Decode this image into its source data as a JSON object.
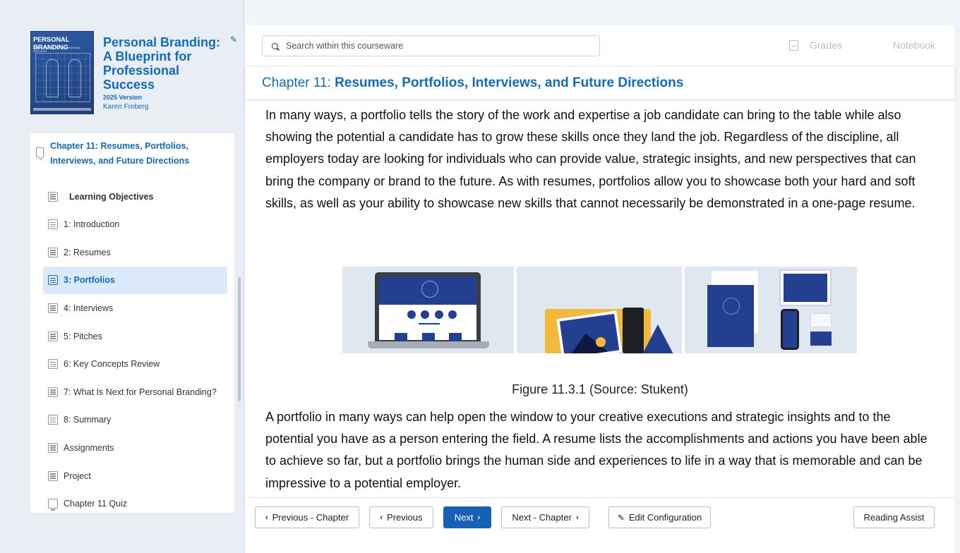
{
  "book": {
    "cover_title": "PERSONAL BRANDING",
    "cover_subtitle": "A BLUEPRINT FOR PROFESSIONAL SUCCESS",
    "title": "Personal Branding: A Blueprint for Professional Success",
    "version": "2025 Version",
    "author": "Karen Freberg"
  },
  "toc": {
    "chapter_label": "Chapter 11: Resumes, Portfolios, Interviews, and Future Directions",
    "items": [
      {
        "label": "Learning Objectives",
        "icon": "page-icon"
      },
      {
        "label": "1: Introduction",
        "icon": "page-icon"
      },
      {
        "label": "2: Resumes",
        "icon": "page-icon"
      },
      {
        "label": "3: Portfolios",
        "icon": "page-icon",
        "active": true
      },
      {
        "label": "4: Interviews",
        "icon": "page-icon"
      },
      {
        "label": "5: Pitches",
        "icon": "page-icon"
      },
      {
        "label": "6: Key Concepts Review",
        "icon": "page-icon"
      },
      {
        "label": "7: What Is Next for Personal Branding?",
        "icon": "page-icon"
      },
      {
        "label": "8: Summary",
        "icon": "page-icon"
      },
      {
        "label": "Assignments",
        "icon": "page-icon"
      },
      {
        "label": "Project",
        "icon": "page-icon"
      },
      {
        "label": "Chapter 11 Quiz",
        "icon": "quiz-icon"
      }
    ]
  },
  "search": {
    "placeholder": "Search within this courseware"
  },
  "topnav": {
    "grades": "Grades",
    "notebook": "Notebook"
  },
  "chapter_header": {
    "prefix": "Chapter 11:",
    "title": "Resumes, Portfolios, Interviews, and Future Directions"
  },
  "content": {
    "paragraph1": "In many ways, a portfolio tells the story of the work and expertise a job candidate can bring to the table while also showing the potential a candidate has to grow these skills once they land the job. Regardless of the discipline, all employers today are looking for individuals who can provide value, strategic insights, and new perspectives that can bring the company or brand to the future. As with resumes, portfolios allow you to showcase both your hard and soft skills, as well as your ability to showcase new skills that cannot necessarily be demonstrated in a one-page resume.",
    "figure_caption": "Figure 11.3.1 (Source: Stukent)",
    "paragraph2": "A portfolio in many ways can help open the window to your creative executions and strategic insights and to the potential you have as a person entering the field. A resume lists the accomplishments and actions you have been able to achieve so far, but a portfolio brings the human side and experiences to life in a way that is memorable and can be impressive to a potential employer."
  },
  "footer": {
    "prev_chapter": "Previous - Chapter",
    "previous": "Previous",
    "next": "Next",
    "next_chapter": "Next - Chapter",
    "edit_config": "Edit Configuration",
    "reading_assist": "Reading Assist"
  },
  "colors": {
    "accent": "#0f6bbf",
    "primary_button": "#1461b6",
    "active_item_bg": "#dbeafb"
  }
}
